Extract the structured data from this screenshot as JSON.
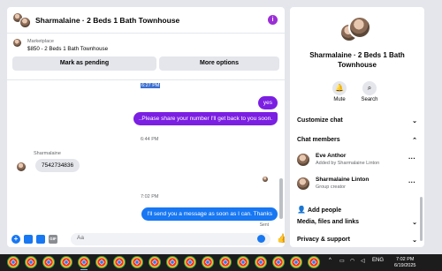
{
  "header": {
    "title": "Sharmalaine · 2 Beds 1 Bath Townhouse",
    "info_icon": "info-icon"
  },
  "listing": {
    "category": "Marketplace",
    "name": "$850 - 2 Beds 1 Bath Townhouse"
  },
  "buttons": {
    "pending": "Mark as pending",
    "more": "More options"
  },
  "messages": {
    "highlight_time": "6:27 PM",
    "out1": "yes",
    "out2": "..Please share your number I'll get back to you soon.",
    "time1": "6:44 PM",
    "sender": "Sharmalaine",
    "in1": "7542734836",
    "time2": "7:02 PM",
    "out3": "I'll send you a message as soon as I can. Thanks",
    "status": "Sent"
  },
  "composer": {
    "placeholder": "Aa"
  },
  "panel": {
    "title": "Sharmalaine · 2 Beds 1 Bath Townhouse",
    "mute": "Mute",
    "search": "Search",
    "customize": "Customize chat",
    "members_header": "Chat members",
    "members": [
      {
        "name": "Eve Anthor",
        "sub": "Added by Sharmalaine Linton"
      },
      {
        "name": "Sharmalaine Linton",
        "sub": "Group creator"
      }
    ],
    "add_people": "Add people",
    "media": "Media, files and links",
    "privacy": "Privacy & support"
  },
  "taskbar": {
    "lang": "ENG",
    "time": "7:02 PM",
    "date": "6/19/2025"
  },
  "colors": {
    "accent_purple": "#7b1fe2",
    "accent_blue": "#1877f2"
  }
}
